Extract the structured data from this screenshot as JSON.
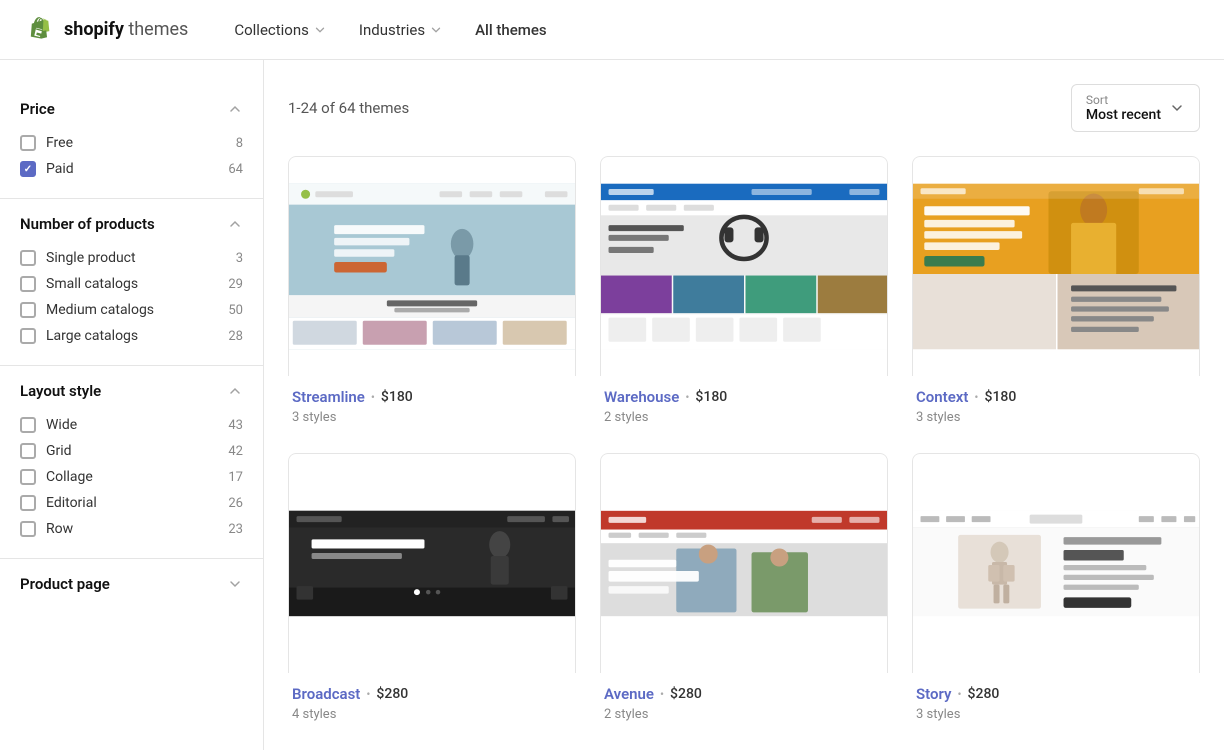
{
  "header": {
    "logo_alt": "Shopify",
    "logo_brand": "shopify",
    "logo_sub": " themes",
    "nav": [
      {
        "id": "collections",
        "label": "Collections",
        "has_dropdown": true
      },
      {
        "id": "industries",
        "label": "Industries",
        "has_dropdown": true
      },
      {
        "id": "all_themes",
        "label": "All themes",
        "has_dropdown": false
      }
    ]
  },
  "sidebar": {
    "sections": [
      {
        "id": "price",
        "title": "Price",
        "expanded": true,
        "items": [
          {
            "id": "free",
            "label": "Free",
            "count": 8,
            "checked": false
          },
          {
            "id": "paid",
            "label": "Paid",
            "count": 64,
            "checked": true
          }
        ]
      },
      {
        "id": "number_of_products",
        "title": "Number of products",
        "expanded": true,
        "items": [
          {
            "id": "single",
            "label": "Single product",
            "count": 3,
            "checked": false
          },
          {
            "id": "small",
            "label": "Small catalogs",
            "count": 29,
            "checked": false
          },
          {
            "id": "medium",
            "label": "Medium catalogs",
            "count": 50,
            "checked": false
          },
          {
            "id": "large",
            "label": "Large catalogs",
            "count": 28,
            "checked": false
          }
        ]
      },
      {
        "id": "layout_style",
        "title": "Layout style",
        "expanded": true,
        "items": [
          {
            "id": "wide",
            "label": "Wide",
            "count": 43,
            "checked": false
          },
          {
            "id": "grid",
            "label": "Grid",
            "count": 42,
            "checked": false
          },
          {
            "id": "collage",
            "label": "Collage",
            "count": 17,
            "checked": false
          },
          {
            "id": "editorial",
            "label": "Editorial",
            "count": 26,
            "checked": false
          },
          {
            "id": "row",
            "label": "Row",
            "count": 23,
            "checked": false
          }
        ]
      },
      {
        "id": "product_page",
        "title": "Product page",
        "expanded": false,
        "items": []
      }
    ]
  },
  "main": {
    "results_text": "1-24 of 64 themes",
    "sort": {
      "label": "Sort",
      "value": "Most recent"
    },
    "themes": [
      {
        "id": "streamline",
        "name": "Streamline",
        "price": "$180",
        "styles": "3 styles",
        "preview_type": "streamline"
      },
      {
        "id": "warehouse",
        "name": "Warehouse",
        "price": "$180",
        "styles": "2 styles",
        "preview_type": "warehouse"
      },
      {
        "id": "context",
        "name": "Context",
        "price": "$180",
        "styles": "3 styles",
        "preview_type": "context"
      },
      {
        "id": "broadcast",
        "name": "Broadcast",
        "price": "$280",
        "styles": "4 styles",
        "preview_type": "broadcast"
      },
      {
        "id": "avenue",
        "name": "Avenue",
        "price": "$280",
        "styles": "2 styles",
        "preview_type": "avenue"
      },
      {
        "id": "story",
        "name": "Story",
        "price": "$280",
        "styles": "3 styles",
        "preview_type": "story"
      }
    ]
  },
  "icons": {
    "chevron_up": "▲",
    "chevron_down": "▼",
    "check": "✓"
  }
}
